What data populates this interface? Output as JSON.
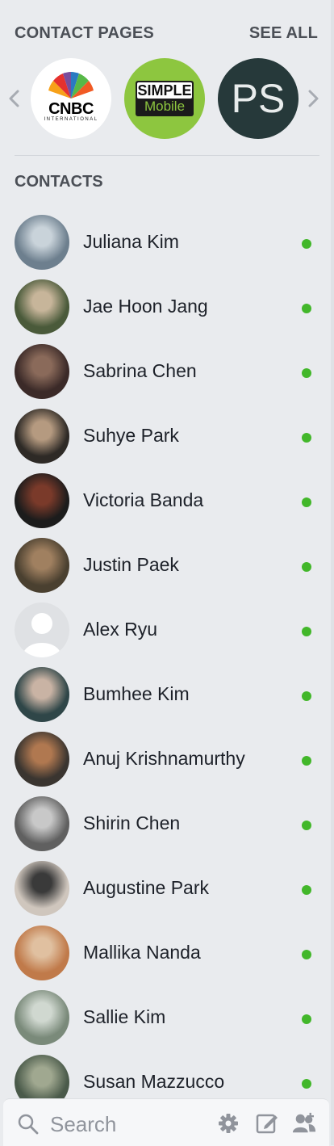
{
  "contact_pages": {
    "heading": "CONTACT PAGES",
    "see_all": "SEE ALL",
    "pages": [
      {
        "name": "CNBC International",
        "logo_text": "CNBC",
        "logo_sub": "INTERNATIONAL",
        "bg": "#ffffff"
      },
      {
        "name": "SIMPLE Mobile",
        "logo_text": "SIMPLE",
        "logo_sub": "Mobile",
        "bg": "#8dc63f"
      },
      {
        "name": "PS",
        "logo_text": "PS",
        "bg": "#26393a"
      }
    ]
  },
  "contacts": {
    "heading": "CONTACTS",
    "items": [
      {
        "name": "Juliana Kim",
        "online": true
      },
      {
        "name": "Jae Hoon Jang",
        "online": true
      },
      {
        "name": "Sabrina Chen",
        "online": true
      },
      {
        "name": "Suhye Park",
        "online": true
      },
      {
        "name": "Victoria Banda",
        "online": true
      },
      {
        "name": "Justin Paek",
        "online": true
      },
      {
        "name": "Alex Ryu",
        "online": true
      },
      {
        "name": "Bumhee Kim",
        "online": true
      },
      {
        "name": "Anuj Krishnamurthy",
        "online": true
      },
      {
        "name": "Shirin Chen",
        "online": true
      },
      {
        "name": "Augustine Park",
        "online": true
      },
      {
        "name": "Mallika Nanda",
        "online": true
      },
      {
        "name": "Sallie Kim",
        "online": true
      },
      {
        "name": "Susan Mazzucco",
        "online": true
      }
    ]
  },
  "search": {
    "placeholder": "Search"
  },
  "colors": {
    "online": "#42b72a",
    "text": "#1d2129",
    "header": "#4b4f56"
  },
  "icons": [
    "search-icon",
    "gear-icon",
    "compose-icon",
    "add-contact-icon",
    "chevron-left-icon",
    "chevron-right-icon"
  ]
}
